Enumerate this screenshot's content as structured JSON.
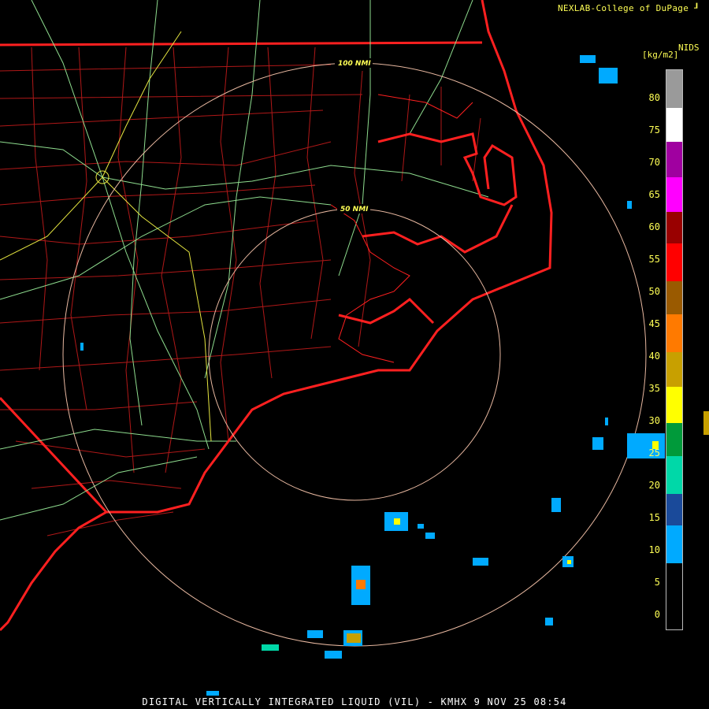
{
  "header": {
    "credit": "NEXLAB-College of DuPage",
    "product_code": "NIDS",
    "units": "[kg/m2]"
  },
  "range_rings": [
    {
      "label": "50 NMI"
    },
    {
      "label": "100 NMI"
    }
  ],
  "legend": {
    "ticks": [
      "80",
      "75",
      "70",
      "65",
      "60",
      "55",
      "50",
      "45",
      "40",
      "35",
      "30",
      "25",
      "20",
      "15",
      "10",
      "5",
      "0"
    ],
    "colors": {
      "gray": "#9a9a9a",
      "white": "#ffffff",
      "magenta": "#ff00ff",
      "dark_magenta": "#a000a0",
      "red": "#ff0000",
      "dark_red": "#990000",
      "brown": "#9a5a00",
      "orange": "#ff7a00",
      "gold": "#c8a000",
      "yellow": "#ffff00",
      "green": "#009a3a",
      "teal": "#00d8a8",
      "dark_blue": "#1a4a9a",
      "cyan": "#00aaff",
      "black": "#000000"
    }
  },
  "map_colors": {
    "coastline": "#ff2020",
    "county_lines": "#b01818",
    "highways_green": "#8edc8e",
    "highways_yellow": "#e6e640",
    "rings": "#e8b8a0"
  },
  "footer": {
    "title": "DIGITAL VERTICALLY INTEGRATED LIQUID (VIL) - KMHX 9 NOV 25 08:54"
  }
}
